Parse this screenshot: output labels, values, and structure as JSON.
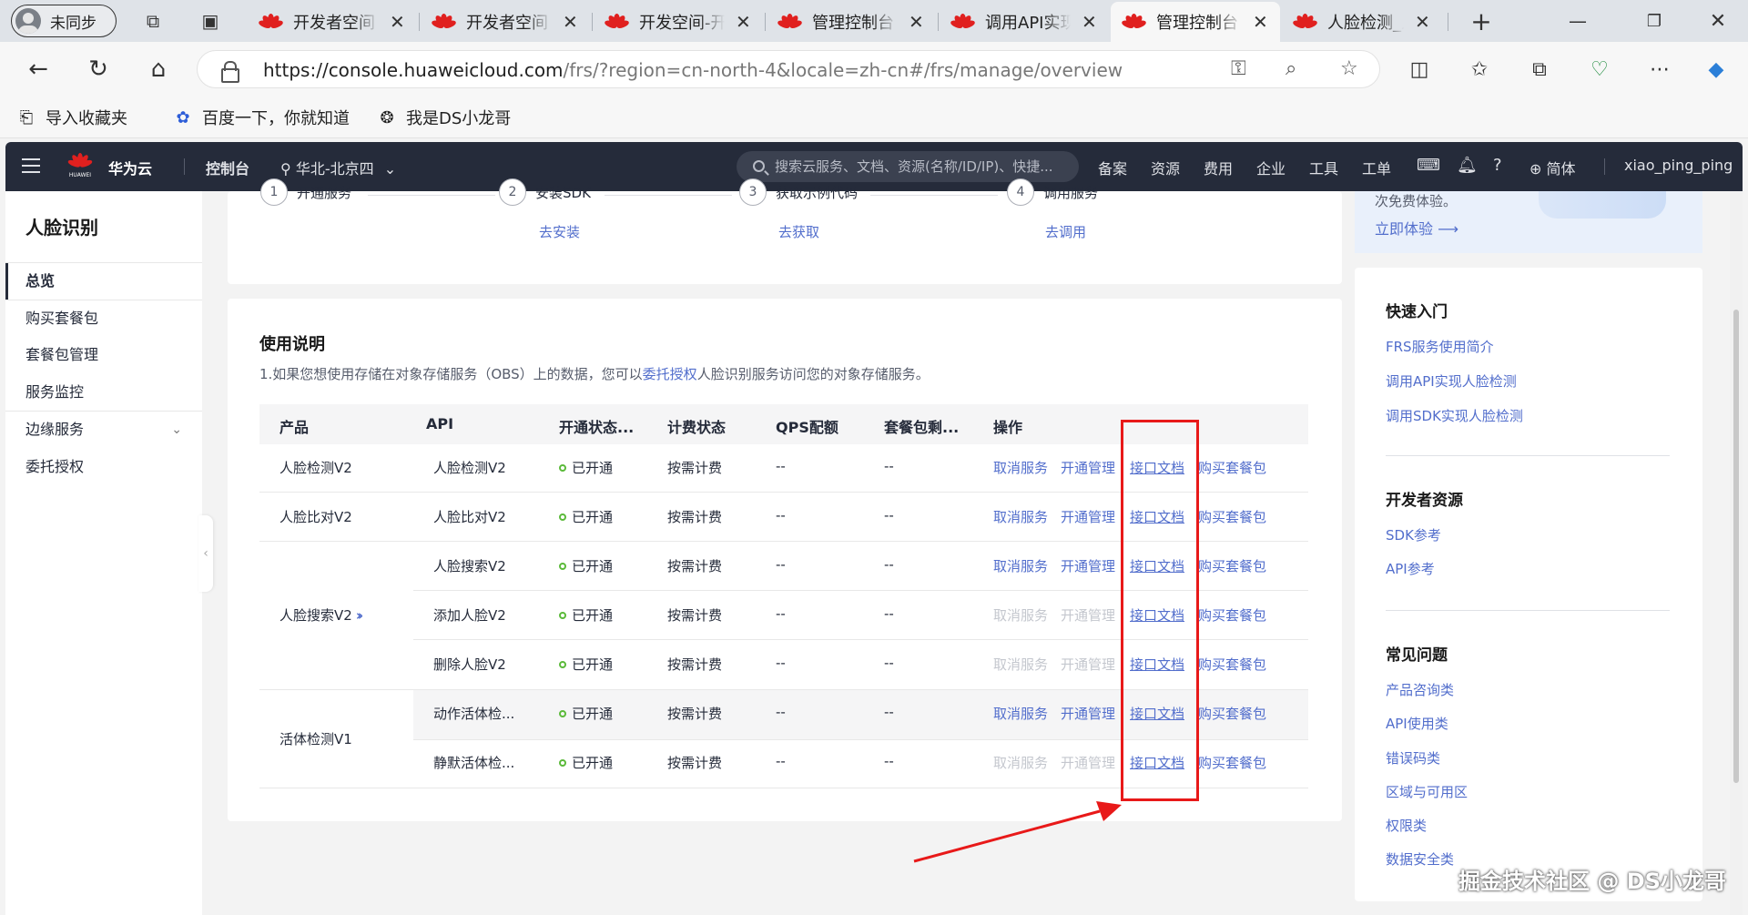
{
  "browser": {
    "profile_label": "未同步",
    "tabs": [
      {
        "label": "开发者空间"
      },
      {
        "label": "开发者空间"
      },
      {
        "label": "开发空间-开"
      },
      {
        "label": "管理控制台"
      },
      {
        "label": "调用API实现"
      },
      {
        "label": "管理控制台"
      },
      {
        "label": "人脸检测_人"
      }
    ],
    "url_host": "https://console.huaweicloud.com",
    "url_path": "/frs/?region=cn-north-4&locale=zh-cn#/frs/manage/overview",
    "bookmarks": [
      "导入收藏夹",
      "百度一下，你就知道",
      "我是DS小龙哥"
    ]
  },
  "console_header": {
    "brand": "华为云",
    "logo_text": "HUAWEI",
    "console_label": "控制台",
    "region": "华北-北京四",
    "search_placeholder": "搜索云服务、文档、资源(名称/ID/IP)、快捷...",
    "menu": [
      "备案",
      "资源",
      "费用",
      "企业",
      "工具",
      "工单"
    ],
    "lang": "简体",
    "username": "xiao_ping_ping"
  },
  "left_nav": {
    "title": "人脸识别",
    "items": [
      "总览",
      "购买套餐包",
      "套餐包管理",
      "服务监控",
      "边缘服务",
      "委托授权"
    ]
  },
  "steps": [
    {
      "num": "1",
      "label": "开通服务",
      "link": ""
    },
    {
      "num": "2",
      "label": "安装SDK",
      "link": "去安装"
    },
    {
      "num": "3",
      "label": "获取示例代码",
      "link": "去获取"
    },
    {
      "num": "4",
      "label": "调用服务",
      "link": "去调用"
    }
  ],
  "usage": {
    "title": "使用说明",
    "desc_before": "1.如果您想使用存储在对象存储服务（OBS）上的数据，您可以",
    "desc_link": "委托授权",
    "desc_after": "人脸识别服务访问您的对象存储服务。"
  },
  "table": {
    "headers": [
      "产品",
      "API",
      "开通状态...",
      "计费状态",
      "QPS配额",
      "套餐包剩...",
      "操作"
    ],
    "products": [
      "人脸检测V2",
      "人脸比对V2",
      "人脸搜索V2",
      "活体检测V1"
    ],
    "rows": [
      {
        "api": "人脸检测V2",
        "status": "已开通",
        "billing": "按需计费",
        "qps": "--",
        "pkg": "--"
      },
      {
        "api": "人脸比对V2",
        "status": "已开通",
        "billing": "按需计费",
        "qps": "--",
        "pkg": "--"
      },
      {
        "api": "人脸搜索V2",
        "status": "已开通",
        "billing": "按需计费",
        "qps": "--",
        "pkg": "--"
      },
      {
        "api": "添加人脸V2",
        "status": "已开通",
        "billing": "按需计费",
        "qps": "--",
        "pkg": "--"
      },
      {
        "api": "删除人脸V2",
        "status": "已开通",
        "billing": "按需计费",
        "qps": "--",
        "pkg": "--"
      },
      {
        "api": "动作活体检...",
        "status": "已开通",
        "billing": "按需计费",
        "qps": "--",
        "pkg": "--"
      },
      {
        "api": "静默活体检...",
        "status": "已开通",
        "billing": "按需计费",
        "qps": "--",
        "pkg": "--"
      }
    ],
    "ops": {
      "cancel": "取消服务",
      "manage": "开通管理",
      "docs": "接口文档",
      "buy": "购买套餐包"
    }
  },
  "right_panel": {
    "promo_text": "次免费体验。",
    "promo_link": "立即体验",
    "quick_start": {
      "title": "快速入门",
      "links": [
        "FRS服务使用简介",
        "调用API实现人脸检测",
        "调用SDK实现人脸检测"
      ]
    },
    "dev_resources": {
      "title": "开发者资源",
      "links": [
        "SDK参考",
        "API参考"
      ]
    },
    "faq": {
      "title": "常见问题",
      "links": [
        "产品咨询类",
        "API使用类",
        "错误码类",
        "区域与可用区",
        "权限类",
        "数据安全类"
      ]
    }
  },
  "watermark": "掘金技术社区 @ DS小龙哥",
  "colors": {
    "accent": "#526ecc",
    "highlight": "#e81919",
    "header_bg": "#252b3a",
    "status_ok": "#5bba3a"
  }
}
